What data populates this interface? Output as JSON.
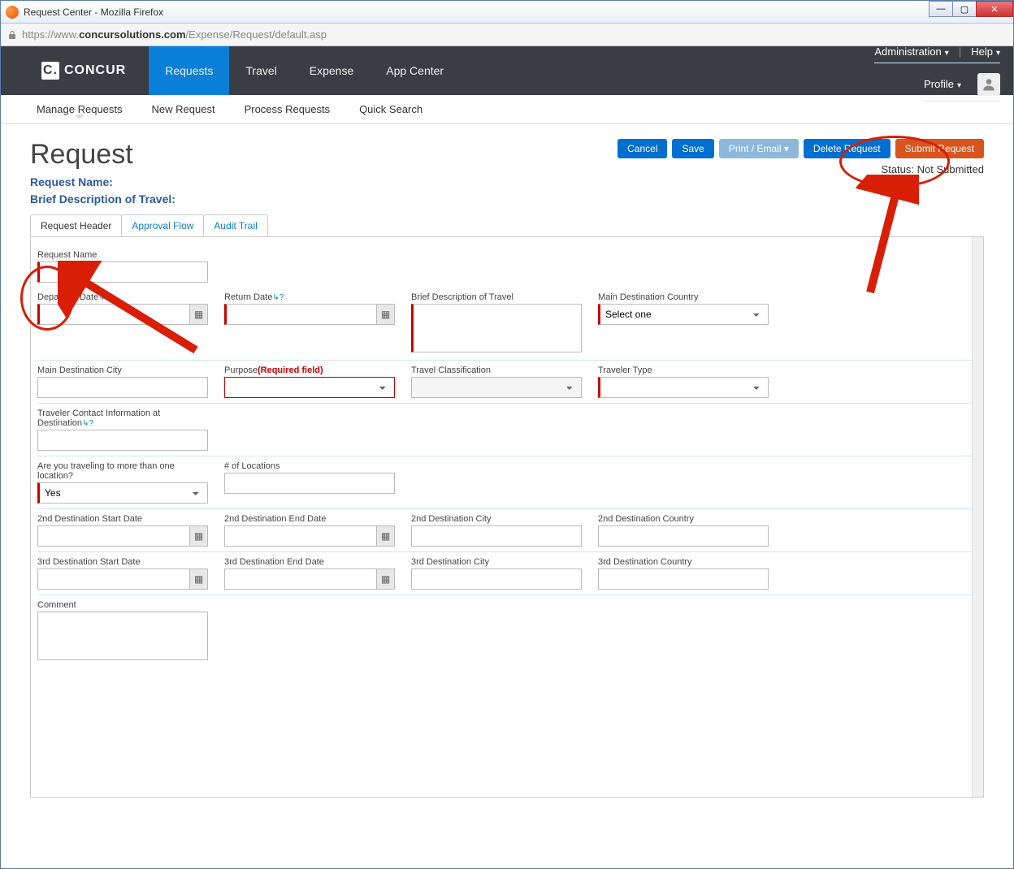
{
  "window": {
    "title": "Request Center - Mozilla Firefox"
  },
  "addressbar": {
    "host_pre": "https://www.",
    "host": "concursolutions.com",
    "path": "/Expense/Request/default.asp"
  },
  "topnav": {
    "brand": "CONCUR",
    "items": [
      "Requests",
      "Travel",
      "Expense",
      "App Center"
    ],
    "util_admin": "Administration",
    "util_help": "Help",
    "util_profile": "Profile"
  },
  "subnav": {
    "items": [
      "Manage Requests",
      "New Request",
      "Process Requests",
      "Quick Search"
    ]
  },
  "page": {
    "title": "Request",
    "status_label": "Status:",
    "status_value": "Not Submitted",
    "meta1": "Request Name:",
    "meta2": "Brief Description of Travel:"
  },
  "buttons": {
    "cancel": "Cancel",
    "save": "Save",
    "print": "Print / Email ▾",
    "delete": "Delete Request",
    "submit": "Submit Request"
  },
  "tabs": {
    "header": "Request Header",
    "approval": "Approval Flow",
    "audit": "Audit Trail"
  },
  "form": {
    "request_name": "Request Name",
    "departure_date": "Departure Date",
    "return_date": "Return Date",
    "brief_desc": "Brief Description of Travel",
    "main_country": "Main Destination Country",
    "main_country_ph": "Select one",
    "main_city": "Main Destination City",
    "purpose": "Purpose",
    "purpose_note": "(Required field)",
    "travel_class": "Travel Classification",
    "traveler_type": "Traveler Type",
    "contact_info": "Traveler Contact Information at Destination",
    "multi_loc": "Are you traveling to more than one location?",
    "multi_loc_val": "Yes",
    "num_loc": "# of Locations",
    "d2_start": "2nd Destination Start Date",
    "d2_end": "2nd Destination End Date",
    "d2_city": "2nd Destination City",
    "d2_country": "2nd Destination Country",
    "d3_start": "3rd Destination Start Date",
    "d3_end": "3rd Destination End Date",
    "d3_city": "3rd Destination City",
    "d3_country": "3rd Destination Country",
    "comment": "Comment",
    "help_glyph": "↳?"
  }
}
